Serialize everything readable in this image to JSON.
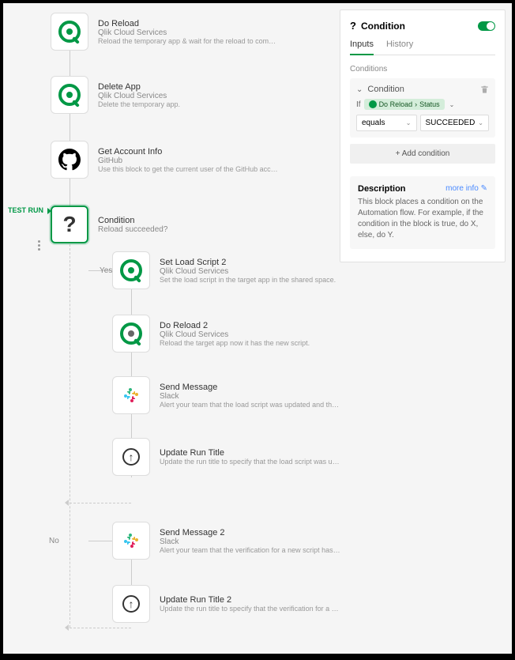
{
  "blocks": {
    "doReload": {
      "title": "Do Reload",
      "sub": "Qlik Cloud Services",
      "desc": "Reload the temporary app & wait for the reload to complete."
    },
    "deleteApp": {
      "title": "Delete App",
      "sub": "Qlik Cloud Services",
      "desc": "Delete the temporary app."
    },
    "getAccount": {
      "title": "Get Account Info",
      "sub": "GitHub",
      "desc": "Use this block to get the current user of the GitHub accou…"
    },
    "condition": {
      "title": "Condition",
      "sub": "Reload succeeded?"
    },
    "setLoad": {
      "title": "Set Load Script 2",
      "sub": "Qlik Cloud Services",
      "desc": "Set the load script in the target app in the shared space."
    },
    "doReload2": {
      "title": "Do Reload 2",
      "sub": "Qlik Cloud Services",
      "desc": "Reload the target app now it has the new script."
    },
    "sendMsg": {
      "title": "Send Message",
      "sub": "Slack",
      "desc": "Alert your team that the load script was updated and the…"
    },
    "updateRun": {
      "title": "Update Run Title",
      "sub": "",
      "desc": "Update the run title to specify that the load script was up…"
    },
    "sendMsg2": {
      "title": "Send Message 2",
      "sub": "Slack",
      "desc": "Alert your team that the verification for a new script has fa…"
    },
    "updateRun2": {
      "title": "Update Run Title 2",
      "sub": "",
      "desc": "Update the run title to specify that the verification for a n…"
    }
  },
  "labels": {
    "yes": "Yes",
    "no": "No",
    "testRun": "TEST RUN"
  },
  "panel": {
    "title": "Condition",
    "tabs": {
      "inputs": "Inputs",
      "history": "History"
    },
    "conditionsLabel": "Conditions",
    "conditionName": "Condition",
    "ifLabel": "If",
    "pill": {
      "block": "Do Reload",
      "field": "Status"
    },
    "operator": "equals",
    "value": "SUCCEEDED",
    "addBtn": "+   Add condition",
    "descTitle": "Description",
    "moreInfo": "more info",
    "descText": "This block places a condition on the Automation flow. For example, if the condition in the block is true, do X, else, do Y."
  }
}
